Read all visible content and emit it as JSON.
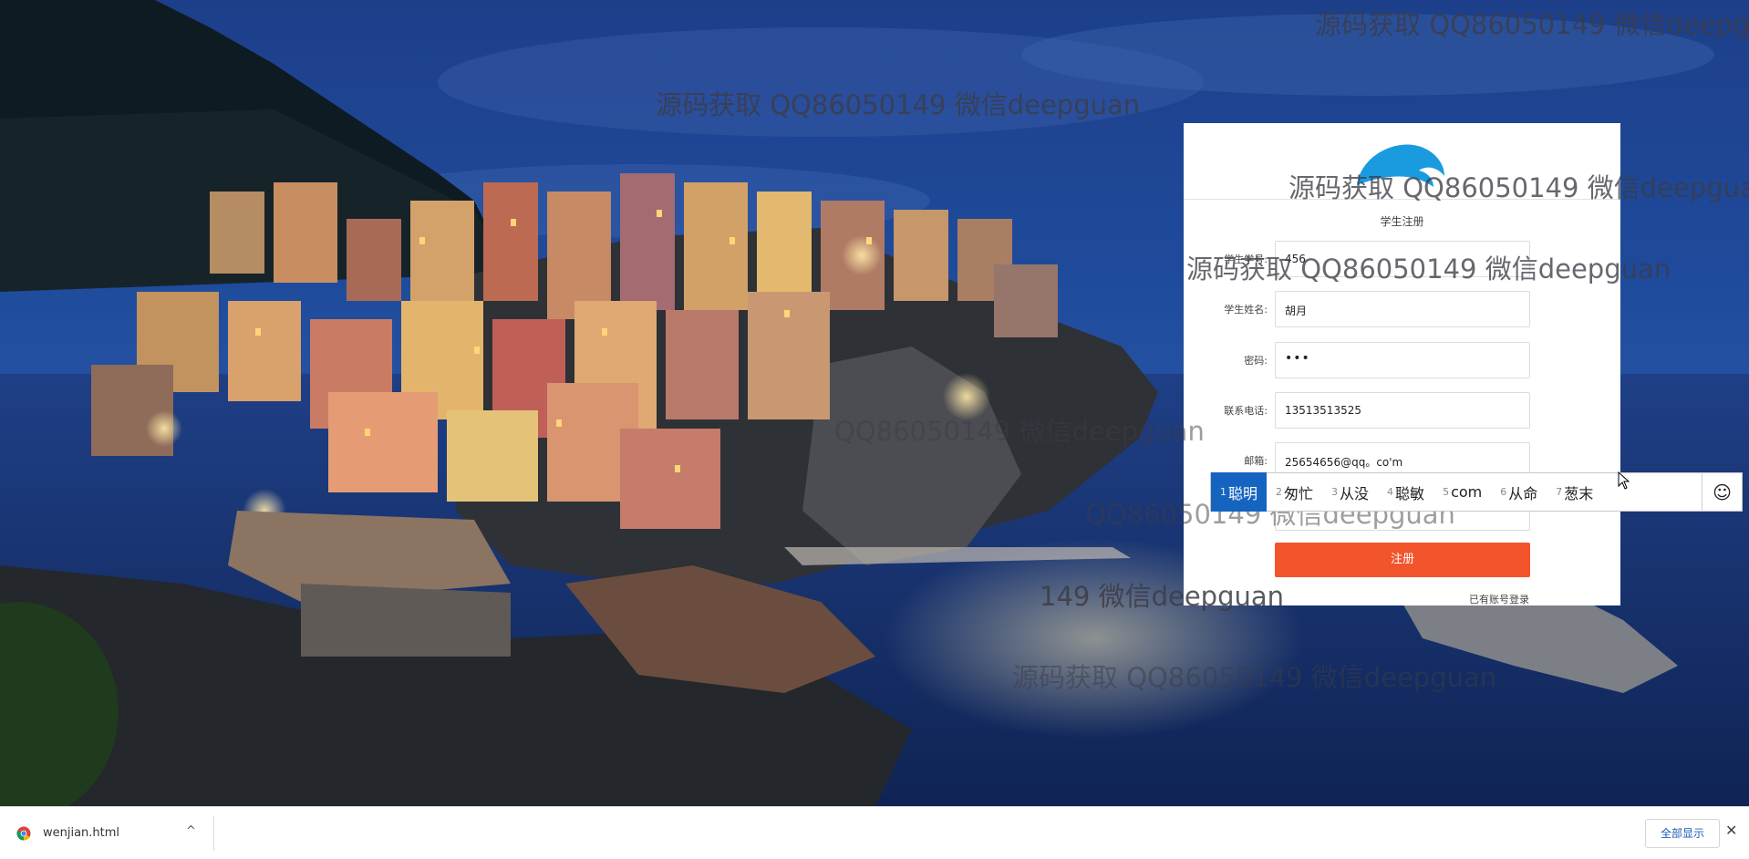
{
  "watermark": {
    "text_main": "源码获取 QQ86050149 微信deepguan",
    "text_cut1": "源码获取 QQ86050149 微信deepgu",
    "text_cut2": "源码获取 QQ86050149 微信deepgua",
    "text_faint1": "QQ86050149 微信deepguan",
    "text_faint2": "QQ86050149 微信deepguan",
    "text_faint3": "149 微信deepguan"
  },
  "form": {
    "title": "学生注册",
    "fields": [
      {
        "label": "学生学号:",
        "value": "456"
      },
      {
        "label": "学生姓名:",
        "value": "胡月"
      },
      {
        "label": "密码:",
        "value": "•••"
      },
      {
        "label": "联系电话:",
        "value": "13513513525"
      },
      {
        "label": "邮箱:",
        "value": "25654656@qq。co'm"
      },
      {
        "label": "",
        "value": ""
      }
    ],
    "submit_label": "注册",
    "login_link": "已有账号登录"
  },
  "ime": {
    "candidates": [
      {
        "n": "1",
        "text": "聪明"
      },
      {
        "n": "2",
        "text": "匆忙"
      },
      {
        "n": "3",
        "text": "从没"
      },
      {
        "n": "4",
        "text": "聪敏"
      },
      {
        "n": "5",
        "text": "com"
      },
      {
        "n": "6",
        "text": "从命"
      },
      {
        "n": "7",
        "text": "葱末"
      }
    ],
    "selected_index": 0,
    "emoji_glyph": "☺"
  },
  "download_shelf": {
    "filename": "wenjian.html",
    "chevron": "^",
    "show_all_label": "全部显示",
    "close_glyph": "✕"
  },
  "colors": {
    "submit": "#f2542b",
    "ime_selected": "#1565c0",
    "logo": "#1a9be0"
  }
}
